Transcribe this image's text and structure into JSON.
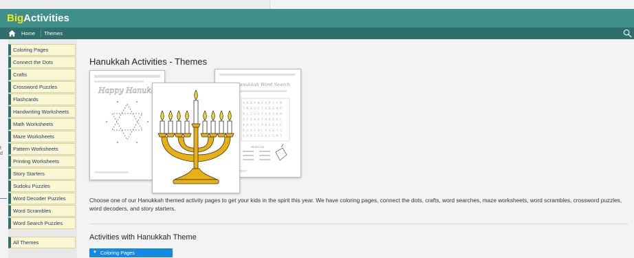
{
  "header": {
    "logo_part1": "Big",
    "logo_part2": "Activities"
  },
  "nav": {
    "items": [
      "Home",
      "Themes"
    ]
  },
  "edge": {
    "text": "t\nd"
  },
  "sidebar": {
    "items": [
      "Coloring Pages",
      "Connect the Dots",
      "Crafts",
      "Crossword Puzzles",
      "Flashcards",
      "Handwriting Worksheets",
      "Math Worksheets",
      "Maze Worksheets",
      "Pattern Worksheets",
      "Printing Worksheets",
      "Story Starters",
      "Sudoku Puzzles",
      "Word Decoder Puzzles",
      "Word Scrambles",
      "Word Search Puzzles"
    ],
    "all_themes": "All Themes"
  },
  "main": {
    "title": "Hanukkah Activities - Themes",
    "images": {
      "left_title": "Happy Hanukkah",
      "right_title": "Hanukkah Word Search",
      "right_subtitle": "Word List"
    },
    "description": "Choose one of our Hanukkah themed activity pages to get your kids in the spirit this year. We have coloring pages, connect the dots, crafts, word searches, maze worksheets, word scrambles, crossword puzzles, word decoders, and story starters.",
    "subheading": "Activities with Hanukkah Theme",
    "dropdown": {
      "label": "Coloring Pages",
      "caret": "▼"
    }
  },
  "colors": {
    "header": "#3f8f8a",
    "nav": "#2f6e6a",
    "sidebar_item": "#fbf7d3",
    "dropdown": "#1688e0",
    "logo_accent": "#f3e71a"
  },
  "icons": [
    "home-icon",
    "search-icon",
    "caret-down-icon"
  ]
}
